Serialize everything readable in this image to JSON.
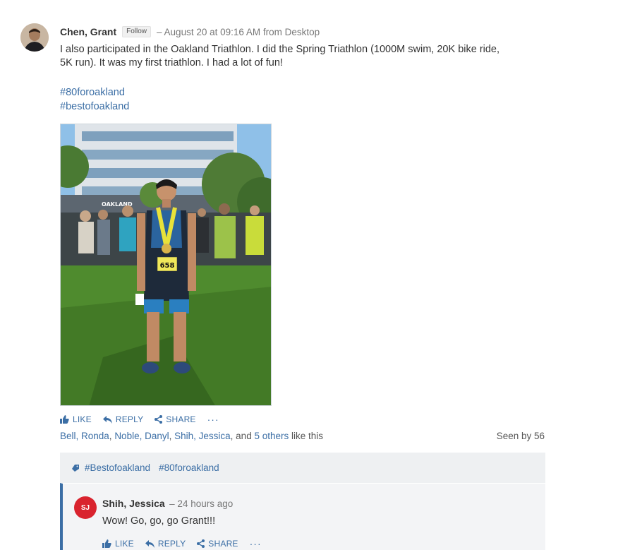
{
  "post": {
    "author": "Chen, Grant",
    "follow_label": "Follow",
    "meta": "– August 20 at 09:16 AM from Desktop",
    "body_line1": "I also participated in the Oakland Triathlon.  I did the Spring Triathlon (1000M swim, 20K bike ride,",
    "body_line2": "5K run).  It was my first triathlon.  I had a lot of fun!",
    "hashtags": [
      "#80foroakland",
      "#bestofoakland"
    ],
    "photo_text": {
      "bib": "658",
      "banner": "OAKLAND"
    }
  },
  "actions": {
    "like": "LIKE",
    "reply": "REPLY",
    "share": "SHARE",
    "more": "···"
  },
  "likes": {
    "names": [
      "Bell, Ronda",
      "Noble, Danyl",
      "Shih, Jessica"
    ],
    "sep1": ", ",
    "sep2": ", ",
    "sep3": ", and ",
    "others": "5 others",
    "suffix": " like this",
    "seen": "Seen by 56"
  },
  "topics": [
    "#Bestofoakland",
    "#80foroakland"
  ],
  "comment": {
    "initials": "SJ",
    "author": "Shih, Jessica",
    "meta": "– 24 hours ago",
    "text": "Wow! Go, go, go Grant!!!",
    "avatar_color": "#d9232e"
  },
  "colors": {
    "link": "#3b6ea5",
    "topic_bg": "#eef0f2",
    "comment_bg": "#f3f4f6"
  }
}
